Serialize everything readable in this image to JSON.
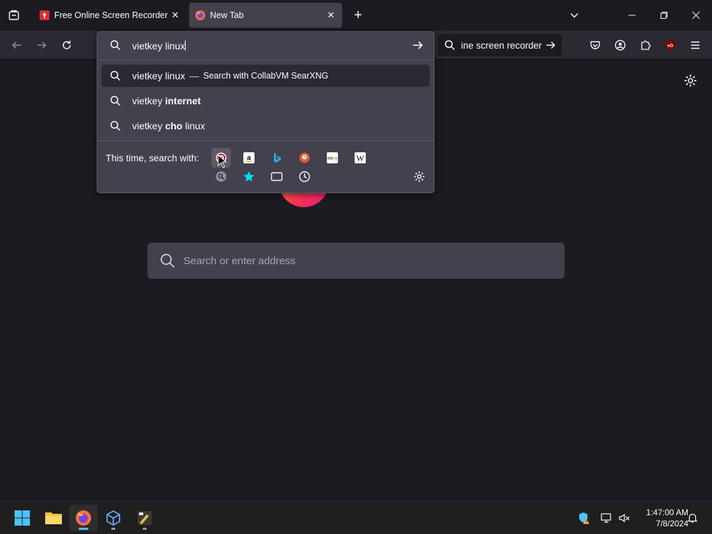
{
  "tabs": [
    {
      "title": "Free Online Screen Recorder & ",
      "close": "✕",
      "active": false
    },
    {
      "title": "New Tab",
      "close": "✕",
      "active": true
    }
  ],
  "new_tab_symbol": "+",
  "searchbar": {
    "text": "ine screen recorder"
  },
  "urlbar": {
    "value": "vietkey linux",
    "results": [
      {
        "prefix": "vietkey linux",
        "bold": "",
        "suffix": "",
        "separator": "—",
        "action": "Search with CollabVM SearXNG"
      },
      {
        "prefix": "vietkey ",
        "bold": "internet",
        "suffix": "",
        "separator": "",
        "action": ""
      },
      {
        "prefix": "vietkey ",
        "bold": "cho",
        "suffix": " linux",
        "separator": "",
        "action": ""
      }
    ],
    "oneoff_label": "This time, search with:",
    "engines": [
      "searxng-icon",
      "amazon-icon",
      "bing-icon",
      "duckduckgo-icon",
      "ebay-icon",
      "wikipedia-icon"
    ],
    "modes": [
      "search-engine-icon",
      "bookmarks-icon",
      "tabs-icon",
      "history-icon"
    ]
  },
  "newtab": {
    "search_placeholder": "Search or enter address"
  },
  "taskbar": {
    "time": "1:47:00 AM",
    "date": "7/8/2024"
  },
  "colors": {
    "accent": "#00ddff",
    "toolbar": "#2b2a33",
    "panel": "#42414d",
    "background": "#1c1b22"
  }
}
